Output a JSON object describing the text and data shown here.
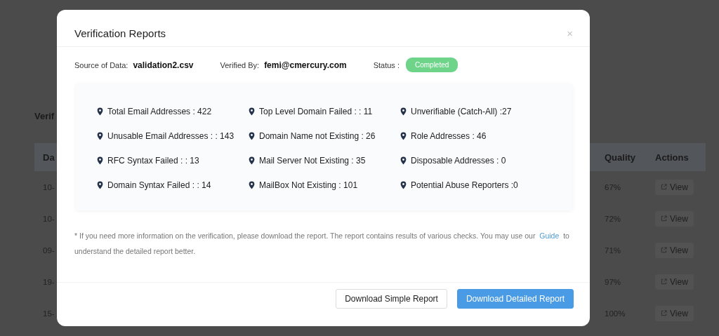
{
  "background_page": {
    "section_heading": "Verif",
    "table": {
      "columns": [
        {
          "label": "Da"
        },
        {
          "label": "Quality"
        },
        {
          "label": "Actions"
        }
      ],
      "rows": [
        {
          "date": "10-",
          "quality": "67%",
          "action": "View"
        },
        {
          "date": "10-",
          "quality": "72%",
          "action": "View"
        },
        {
          "date": "09-",
          "quality": "71%",
          "action": "View"
        },
        {
          "date": "19-",
          "quality": "97%",
          "action": "View"
        },
        {
          "date": "15-",
          "quality": "100%",
          "action": "View"
        }
      ]
    }
  },
  "modal": {
    "title": "Verification Reports",
    "close": "×",
    "source_label": "Source of Data:",
    "source_value": "validation2.csv",
    "verified_label": "Verified By:",
    "verified_value": "femi@cmercury.com",
    "status_label": "Status :",
    "status": "Completed",
    "stats": [
      "Total Email Addresses : 422",
      "Top Level Domain Failed : : 11",
      "Unverifiable (Catch-All) :27",
      "Unusable Email Addresses : : 143",
      "Domain Name not Existing : 26",
      "Role Addresses : 46",
      "RFC Syntax Failed : : 13",
      "Mail Server Not Existing : 35",
      "Disposable Addresses : 0",
      "Domain Syntax Failed : : 14",
      "MailBox Not Existing : 101",
      "Potential Abuse Reporters :0"
    ],
    "note": {
      "text_before": "* If you need more information on the verification, please download the report. The report contains results of various checks. You may use our",
      "link": "Guide",
      "text_after": "to understand the detailed report better."
    },
    "buttons": [
      {
        "label": "Download Simple Report",
        "kind": "secondary"
      },
      {
        "label": "Download Detailed Report",
        "kind": "primary"
      }
    ]
  }
}
